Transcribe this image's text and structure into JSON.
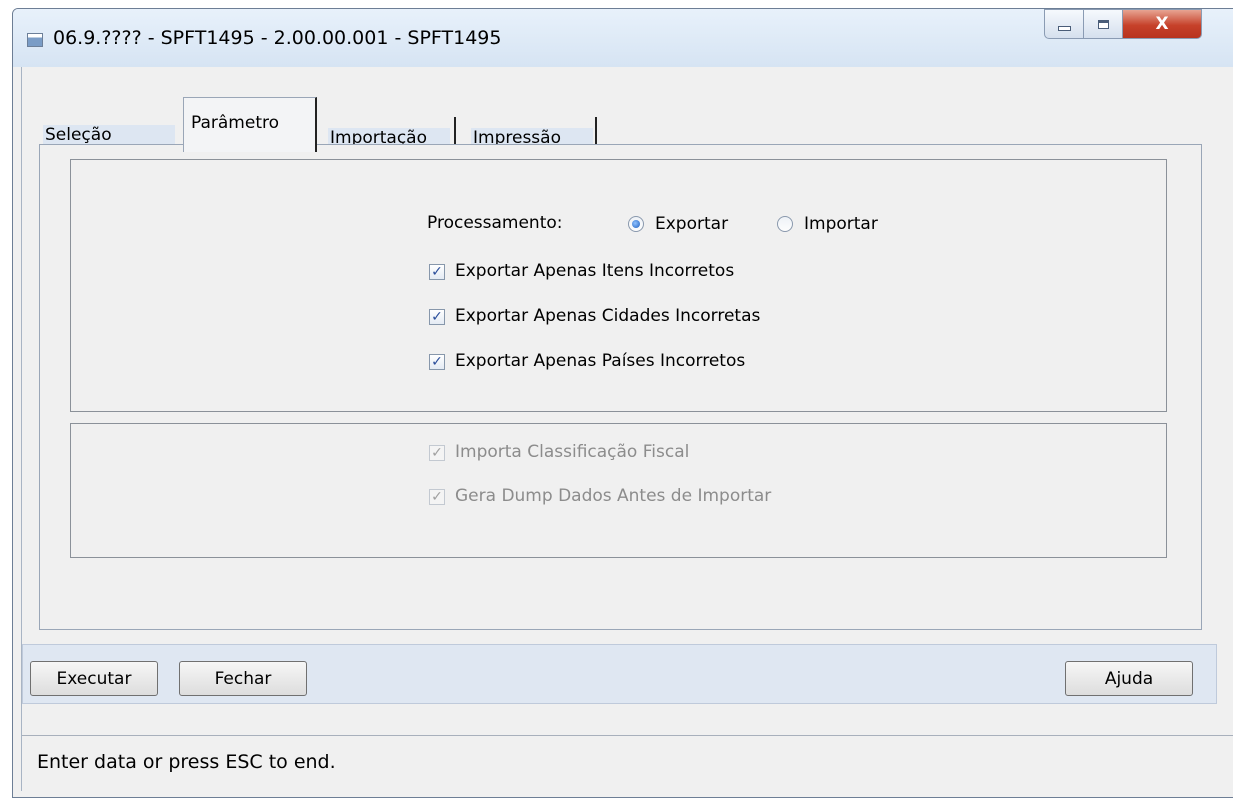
{
  "window": {
    "title": "06.9.???? - SPFT1495 - 2.00.00.001 - SPFT1495",
    "close_glyph": "X"
  },
  "tabs": [
    {
      "label": "Seleção",
      "active": false
    },
    {
      "label": "Parâmetro",
      "active": true
    },
    {
      "label": "Importação",
      "active": false
    },
    {
      "label": "Impressão",
      "active": false
    }
  ],
  "processamento": {
    "label": "Processamento:",
    "options": [
      {
        "label": "Exportar",
        "selected": true
      },
      {
        "label": "Importar",
        "selected": false
      }
    ]
  },
  "export_options": [
    {
      "label": "Exportar Apenas Itens Incorretos",
      "checked": true
    },
    {
      "label": "Exportar Apenas Cidades Incorretas",
      "checked": true
    },
    {
      "label": "Exportar Apenas Países Incorretos",
      "checked": true
    }
  ],
  "import_options": [
    {
      "label": "Importa Classificação Fiscal",
      "checked": true,
      "enabled": false
    },
    {
      "label": "Gera Dump Dados Antes de Importar",
      "checked": true,
      "enabled": false
    }
  ],
  "buttons": {
    "executar": "Executar",
    "fechar": "Fechar",
    "ajuda": "Ajuda"
  },
  "status": "Enter data or press ESC to end.",
  "check_glyph": "✓",
  "colors": {
    "panel_bg": "#f0f0f0",
    "button_bar_bg": "#dfe7f2",
    "tab_label_bg": "#dde6f2",
    "close_button": "#c6412a"
  }
}
